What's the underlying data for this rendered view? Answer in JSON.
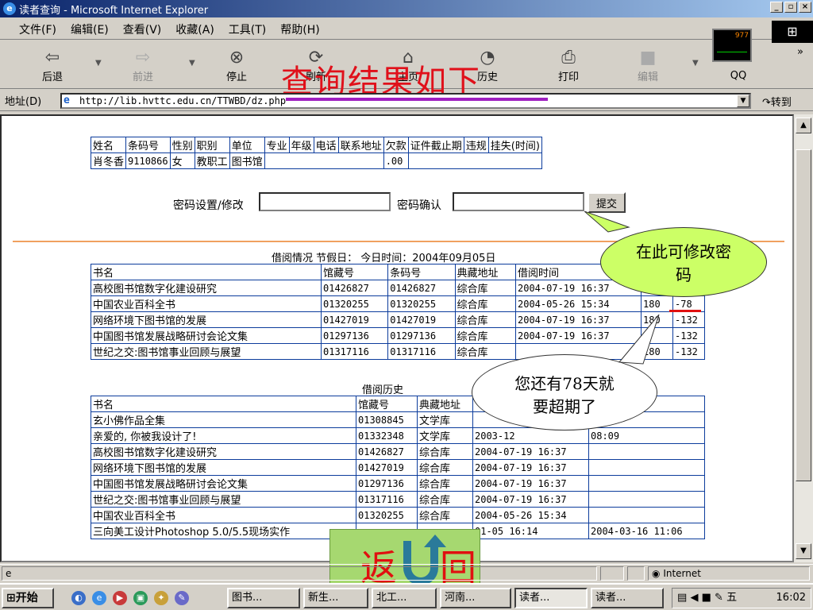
{
  "window": {
    "title": "读者查询 - Microsoft Internet Explorer"
  },
  "menu": [
    "文件(F)",
    "编辑(E)",
    "查看(V)",
    "收藏(A)",
    "工具(T)",
    "帮助(H)"
  ],
  "netmeter": {
    "value": "977"
  },
  "toolbar": {
    "back": "后退",
    "forward": "前进",
    "stop": "停止",
    "refresh": "刷新",
    "home": "主页",
    "history": "历史",
    "print": "打印",
    "edit": "编辑",
    "qq": "QQ"
  },
  "address": {
    "label": "地址(D)",
    "url": "http://lib.hvttc.edu.cn/TTWBD/dz.php",
    "go": "转到"
  },
  "annotation": {
    "title": "查询结果如下",
    "callout_password": "在此可修改密码",
    "callout_overdue": "您还有78天就要超期了",
    "return_left": "返",
    "return_right": "回"
  },
  "reader": {
    "headers": [
      "姓名",
      "条码号",
      "性别",
      "职别",
      "单位",
      "专业",
      "年级",
      "电话",
      "联系地址",
      "欠款",
      "证件截止期",
      "违规",
      "挂失(时间)"
    ],
    "values": [
      "肖冬香",
      "9110866",
      "女",
      "教职工",
      "图书馆",
      "",
      "",
      "",
      "",
      ".00",
      "",
      "",
      ""
    ]
  },
  "password": {
    "set_label": "密码设置/修改",
    "confirm_label": "密码确认",
    "submit": "提交"
  },
  "borrow": {
    "caption": "借阅情况 节假日： 今日时间：2004年09月05日",
    "headers": [
      "书名",
      "馆藏号",
      "条码号",
      "典藏地址",
      "借阅时间",
      "",
      ""
    ],
    "rows": [
      [
        "高校图书馆数字化建设研究",
        "01426827",
        "01426827",
        "综合库",
        "2004-07-19 16:37",
        "180",
        ""
      ],
      [
        "中国农业百科全书",
        "01320255",
        "01320255",
        "综合库",
        "2004-05-26 15:34",
        "180",
        "-78"
      ],
      [
        "网络环境下图书馆的发展",
        "01427019",
        "01427019",
        "综合库",
        "2004-07-19 16:37",
        "180",
        "-132"
      ],
      [
        "中国图书馆发展战略研讨会论文集",
        "01297136",
        "01297136",
        "综合库",
        "2004-07-19 16:37",
        "",
        "-132"
      ],
      [
        "世纪之交:图书馆事业回顾与展望",
        "01317116",
        "01317116",
        "综合库",
        "",
        "180",
        "-132"
      ]
    ]
  },
  "history": {
    "caption": "借阅历史",
    "headers": [
      "书名",
      "馆藏号",
      "典藏地址",
      "",
      ""
    ],
    "rows": [
      [
        "玄小佛作品全集",
        "01308845",
        "文学库",
        "",
        "08:09"
      ],
      [
        "亲爱的, 你被我设计了!",
        "01332348",
        "文学库",
        "2003-12",
        "08:09"
      ],
      [
        "高校图书馆数字化建设研究",
        "01426827",
        "综合库",
        "2004-07-19 16:37",
        ""
      ],
      [
        "网络环境下图书馆的发展",
        "01427019",
        "综合库",
        "2004-07-19 16:37",
        ""
      ],
      [
        "中国图书馆发展战略研讨会论文集",
        "01297136",
        "综合库",
        "2004-07-19 16:37",
        ""
      ],
      [
        "世纪之交:图书馆事业回顾与展望",
        "01317116",
        "综合库",
        "2004-07-19 16:37",
        ""
      ],
      [
        "中国农业百科全书",
        "01320255",
        "综合库",
        "2004-05-26 15:34",
        ""
      ],
      [
        "三向美工设计Photoshop 5.0/5.5现场实作",
        "",
        "",
        "01-05 16:14",
        "2004-03-16 11:06"
      ]
    ]
  },
  "status": {
    "zone": "Internet"
  },
  "taskbar": {
    "start": "开始",
    "tasks": [
      "图书...",
      "新生...",
      "北工...",
      "河南...",
      "读者...",
      "读者..."
    ],
    "clock": "16:02"
  }
}
